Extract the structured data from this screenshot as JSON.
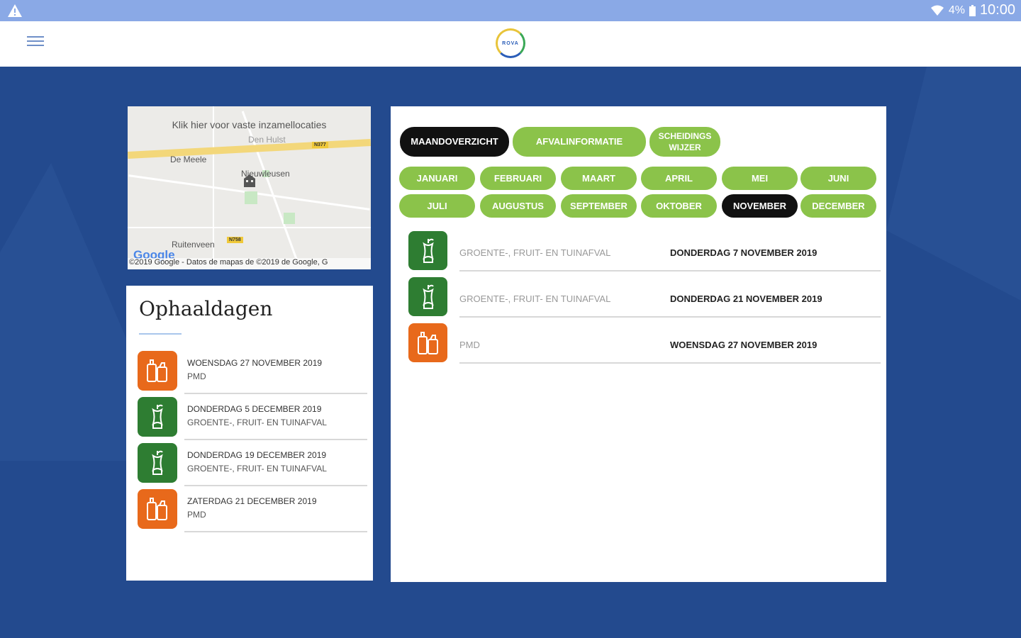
{
  "statusbar": {
    "battery": "4%",
    "time": "10:00"
  },
  "app": {
    "logo_text": "ROVA"
  },
  "map": {
    "hint": "Klik hier voor vaste inzamellocaties",
    "places": [
      "Den Hulst",
      "De Meele",
      "Nieuwleusen",
      "Ruitenveen"
    ],
    "roads": [
      "N377",
      "N758"
    ],
    "google": "Google",
    "attribution": "©2019 Google - Datos de mapas de ©2019 de Google, G"
  },
  "pickup": {
    "title": "Ophaaldagen",
    "items": [
      {
        "date": "WOENSDAG 27 NOVEMBER 2019",
        "type": "PMD",
        "kind": "pmd"
      },
      {
        "date": "DONDERDAG 5 DECEMBER 2019",
        "type": "GROENTE-, FRUIT- EN TUINAFVAL",
        "kind": "gft"
      },
      {
        "date": "DONDERDAG 19 DECEMBER 2019",
        "type": "GROENTE-, FRUIT- EN TUINAFVAL",
        "kind": "gft"
      },
      {
        "date": "ZATERDAG 21 DECEMBER 2019",
        "type": "PMD",
        "kind": "pmd"
      }
    ]
  },
  "tabs": {
    "maandoverzicht": "MAANDOVERZICHT",
    "afvalinformatie": "AFVALINFORMATIE",
    "scheidingswijzer": "SCHEIDINGS WIJZER",
    "active": "MAANDOVERZICHT"
  },
  "months": [
    "JANUARI",
    "FEBRUARI",
    "MAART",
    "APRIL",
    "MEI",
    "JUNI",
    "JULI",
    "AUGUSTUS",
    "SEPTEMBER",
    "OKTOBER",
    "NOVEMBER",
    "DECEMBER"
  ],
  "active_month": "NOVEMBER",
  "entries": [
    {
      "type": "GROENTE-, FRUIT- EN TUINAFVAL",
      "date": "DONDERDAG 7 NOVEMBER 2019",
      "kind": "gft"
    },
    {
      "type": "GROENTE-, FRUIT- EN TUINAFVAL",
      "date": "DONDERDAG 21 NOVEMBER 2019",
      "kind": "gft"
    },
    {
      "type": "PMD",
      "date": "WOENSDAG 27 NOVEMBER 2019",
      "kind": "pmd"
    }
  ],
  "colors": {
    "gft": "#2e7d32",
    "pmd": "#e8691b",
    "pill": "#8bc34a",
    "pill_active": "#111111",
    "background": "#234a8e"
  }
}
